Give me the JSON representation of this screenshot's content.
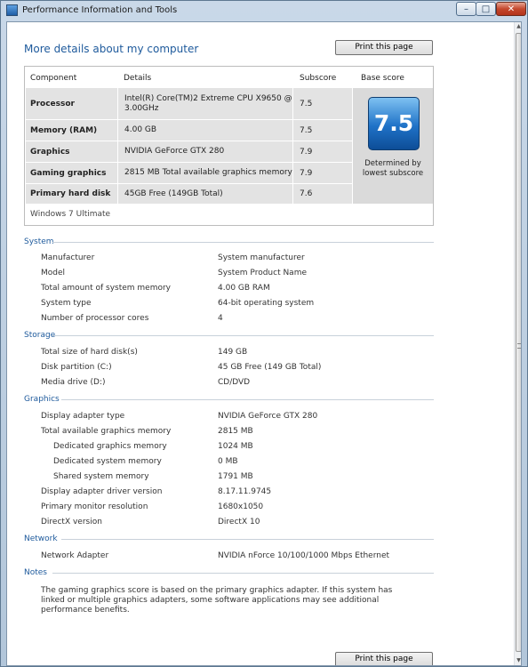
{
  "window": {
    "title": "Performance Information and Tools",
    "min": "–",
    "max": "□",
    "close": "✕"
  },
  "page_title": "More details about my computer",
  "print_label": "Print this page",
  "scores": {
    "headers": {
      "component": "Component",
      "details": "Details",
      "subscore": "Subscore",
      "base": "Base score"
    },
    "rows": [
      {
        "component": "Processor",
        "details": "Intel(R) Core(TM)2 Extreme CPU X9650 @ 3.00GHz",
        "subscore": "7.5"
      },
      {
        "component": "Memory (RAM)",
        "details": "4.00 GB",
        "subscore": "7.5"
      },
      {
        "component": "Graphics",
        "details": "NVIDIA GeForce GTX 280",
        "subscore": "7.9"
      },
      {
        "component": "Gaming graphics",
        "details": "2815 MB Total available graphics memory",
        "subscore": "7.9"
      },
      {
        "component": "Primary hard disk",
        "details": "45GB Free (149GB Total)",
        "subscore": "7.6"
      }
    ],
    "base_score": "7.5",
    "determined_by": "Determined by lowest subscore",
    "os": "Windows 7 Ultimate"
  },
  "sections": {
    "system": {
      "title": "System",
      "rows": [
        {
          "label": "Manufacturer",
          "value": "System manufacturer"
        },
        {
          "label": "Model",
          "value": "System Product Name"
        },
        {
          "label": "Total amount of system memory",
          "value": "4.00 GB RAM"
        },
        {
          "label": "System type",
          "value": "64-bit operating system"
        },
        {
          "label": "Number of processor cores",
          "value": "4"
        }
      ]
    },
    "storage": {
      "title": "Storage",
      "rows": [
        {
          "label": "Total size of hard disk(s)",
          "value": "149 GB"
        },
        {
          "label": "Disk partition (C:)",
          "value": "45 GB Free (149 GB Total)"
        },
        {
          "label": "Media drive (D:)",
          "value": "CD/DVD"
        }
      ]
    },
    "graphics": {
      "title": "Graphics",
      "rows": [
        {
          "label": "Display adapter type",
          "value": "NVIDIA GeForce GTX 280"
        },
        {
          "label": "Total available graphics memory",
          "value": "2815 MB"
        },
        {
          "label": "Dedicated graphics memory",
          "value": "1024 MB"
        },
        {
          "label": "Dedicated system memory",
          "value": "0 MB"
        },
        {
          "label": "Shared system memory",
          "value": "1791 MB"
        },
        {
          "label": "Display adapter driver version",
          "value": "8.17.11.9745"
        },
        {
          "label": "Primary monitor resolution",
          "value": "1680x1050"
        },
        {
          "label": "DirectX version",
          "value": "DirectX 10"
        }
      ]
    },
    "network": {
      "title": "Network",
      "rows": [
        {
          "label": "Network Adapter",
          "value": "NVIDIA nForce 10/100/1000 Mbps Ethernet"
        }
      ]
    },
    "notes": {
      "title": "Notes",
      "text": "The gaming graphics score is based on the primary graphics adapter. If this system has linked or multiple graphics adapters, some software applications may see additional performance benefits."
    }
  }
}
